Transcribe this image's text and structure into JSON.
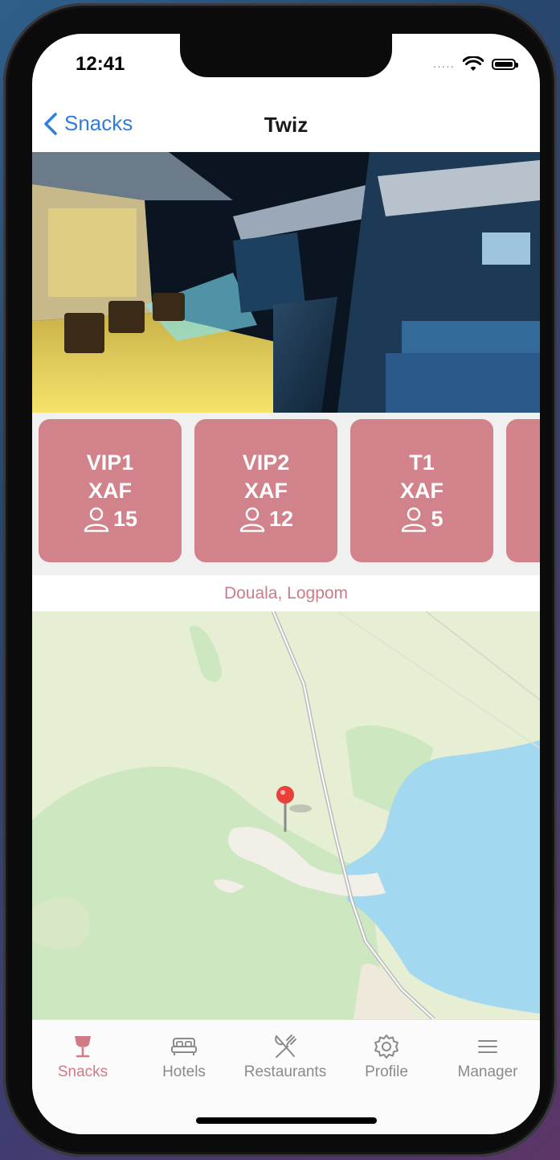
{
  "status": {
    "time": "12:41",
    "signal": "....."
  },
  "nav": {
    "back_label": "Snacks",
    "title": "Twiz"
  },
  "tables": [
    {
      "name": "VIP1",
      "currency": "XAF",
      "capacity": "15"
    },
    {
      "name": "VIP2",
      "currency": "XAF",
      "capacity": "12"
    },
    {
      "name": "T1",
      "currency": "XAF",
      "capacity": "5"
    }
  ],
  "address": "Douala, Logpom",
  "tabs": [
    {
      "label": "Snacks",
      "icon": "wine-glass-icon",
      "active": true
    },
    {
      "label": "Hotels",
      "icon": "bed-icon",
      "active": false
    },
    {
      "label": "Restaurants",
      "icon": "fork-knife-icon",
      "active": false
    },
    {
      "label": "Profile",
      "icon": "gear-icon",
      "active": false
    },
    {
      "label": "Manager",
      "icon": "menu-icon",
      "active": false
    }
  ],
  "colors": {
    "accent": "#2f7de1",
    "card": "#d1828b",
    "tab_active": "#cf7a86",
    "water": "#a3d8f1",
    "park": "#cde8c0"
  }
}
